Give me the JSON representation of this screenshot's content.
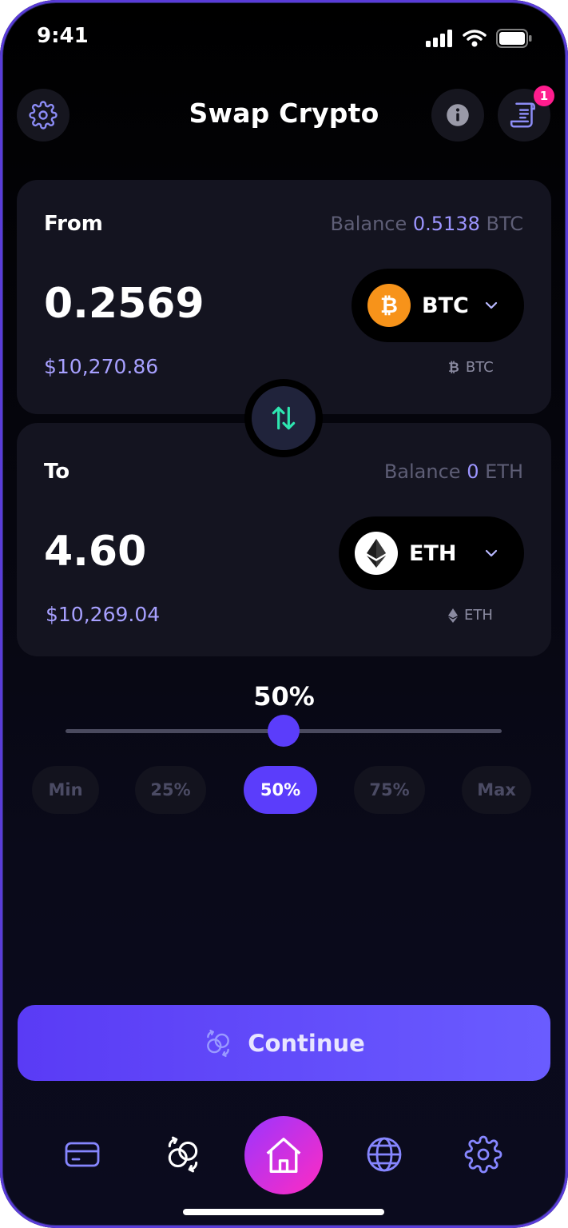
{
  "status_bar": {
    "time": "9:41",
    "icons": [
      "signal-icon",
      "wifi-icon",
      "battery-icon"
    ]
  },
  "header": {
    "title": "Swap Crypto",
    "notification_count": "1",
    "icons": [
      "gear-icon",
      "info-icon",
      "receipt-icon"
    ]
  },
  "from": {
    "label": "From",
    "balance_prefix": "Balance",
    "balance_value": "0.5138",
    "balance_unit": "BTC",
    "amount": "0.2569",
    "usd_value": "$10,270.86",
    "token_symbol": "BTC",
    "token_sub_symbol": "BTC",
    "coin_color": "#F7931A"
  },
  "to": {
    "label": "To",
    "balance_prefix": "Balance",
    "balance_value": "0",
    "balance_unit": "ETH",
    "amount": "4.60",
    "usd_value": "$10,269.04",
    "token_symbol": "ETH",
    "token_sub_symbol": "ETH"
  },
  "slider": {
    "label": "50%",
    "value_fraction": 0.5
  },
  "presets": [
    {
      "label": "Min",
      "active": false
    },
    {
      "label": "25%",
      "active": false
    },
    {
      "label": "50%",
      "active": true
    },
    {
      "label": "75%",
      "active": false
    },
    {
      "label": "Max",
      "active": false
    }
  ],
  "continue_label": "Continue",
  "bottom_nav": [
    "card-icon",
    "swap-icon",
    "home-icon",
    "globe-icon",
    "gear-icon"
  ],
  "colors": {
    "accent": "#5B3DFB",
    "balance_highlight": "#9C95FF",
    "badge": "#FF1D8E",
    "swap_arrows": "#2EE6B0"
  }
}
